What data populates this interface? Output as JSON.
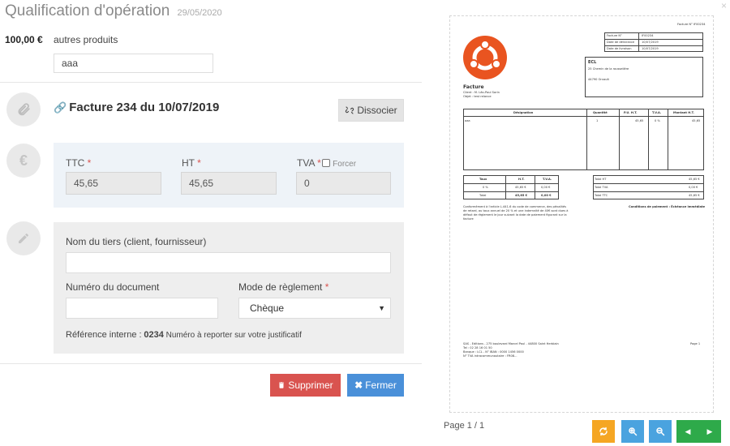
{
  "header": {
    "title": "Qualification d'opération",
    "date": "29/05/2020"
  },
  "operation": {
    "amount": "100,00 €",
    "category": "autres produits",
    "note_value": "aaa"
  },
  "invoice": {
    "title": "Facture 234 du 10/07/2019",
    "dissocier_label": "Dissocier"
  },
  "taxes": {
    "ttc_label": "TTC",
    "ttc_value": "45,65",
    "ht_label": "HT",
    "ht_value": "45,65",
    "tva_label": "TVA",
    "tva_value": "0",
    "forcer_label": "Forcer",
    "required_mark": "*"
  },
  "form": {
    "tiers_label": "Nom du tiers (client, fournisseur)",
    "tiers_value": "",
    "doc_label": "Numéro du document",
    "doc_value": "",
    "mode_label": "Mode de règlement",
    "mode_value": "Chèque",
    "ref_label": "Référence interne :",
    "ref_value": "0234",
    "ref_hint": "Numéro à reporter sur votre justificatif"
  },
  "actions": {
    "delete_label": "Supprimer",
    "close_label": "Fermer"
  },
  "preview": {
    "doc_ref": "Facture N° IF00234",
    "meta_labels": [
      "Facture N°",
      "Date de délivrance",
      "Date de livraison"
    ],
    "meta_values": [
      "IF00234",
      "10/07/2019",
      "10/07/2019"
    ],
    "recipient_name": "ECL",
    "recipient_street": "25 Chemin de la rousselière",
    "recipient_city": "44790 Orvault",
    "doc_type": "Facture",
    "client_line": "Client : M. Léo-Paul Sorin",
    "object_line": "Objet : test relance",
    "table_headers": [
      "Désignation",
      "Quantité",
      "P.U. H.T.",
      "T.V.A.",
      "Montant H.T."
    ],
    "table_row": [
      "aaa",
      "1",
      "45,65",
      "0 %",
      "45,65"
    ],
    "vat_headers": [
      "Taux",
      "H.T.",
      "T.V.A."
    ],
    "vat_row": [
      "0 %",
      "45,65 €",
      "0,00 €"
    ],
    "vat_total": [
      "Total",
      "45,65 €",
      "0,00 €"
    ],
    "totals_labels": [
      "Total HT",
      "Total TVA",
      "Total TTC"
    ],
    "totals_values": [
      "45,65 €",
      "0,00 €",
      "45,65 €"
    ],
    "legal_1": "Conformément à l'article L.441-6 du code de commerce, des pénalités",
    "legal_2": "de retard, au taux annuel de 20 % et une indemnité de 40€ sont dues à",
    "legal_3": "défaut de règlement le jour suivant la date de paiement figurant sur la",
    "legal_4": "facture",
    "payment_terms": "Conditions de paiement : Échéance immédiate",
    "footer_1": "SAS - Editions - 275 boulevard Marcel Paul - 44800 Saint Herblain",
    "footer_2": "Tel : 02 28 16 01 50",
    "footer_3": "Banque : LCL - N° IBAN : 0000 1456 0000",
    "footer_4": "N° TVA intracommunautaire : FR08...",
    "footer_page": "Page 1"
  },
  "pager": {
    "label": "Page 1 / 1"
  },
  "colors": {
    "danger": "#d9534f",
    "primary": "#4a90d9",
    "orange": "#f5a623",
    "info": "#4aa3df",
    "success": "#2eaa4a",
    "logo": "#e95420"
  }
}
